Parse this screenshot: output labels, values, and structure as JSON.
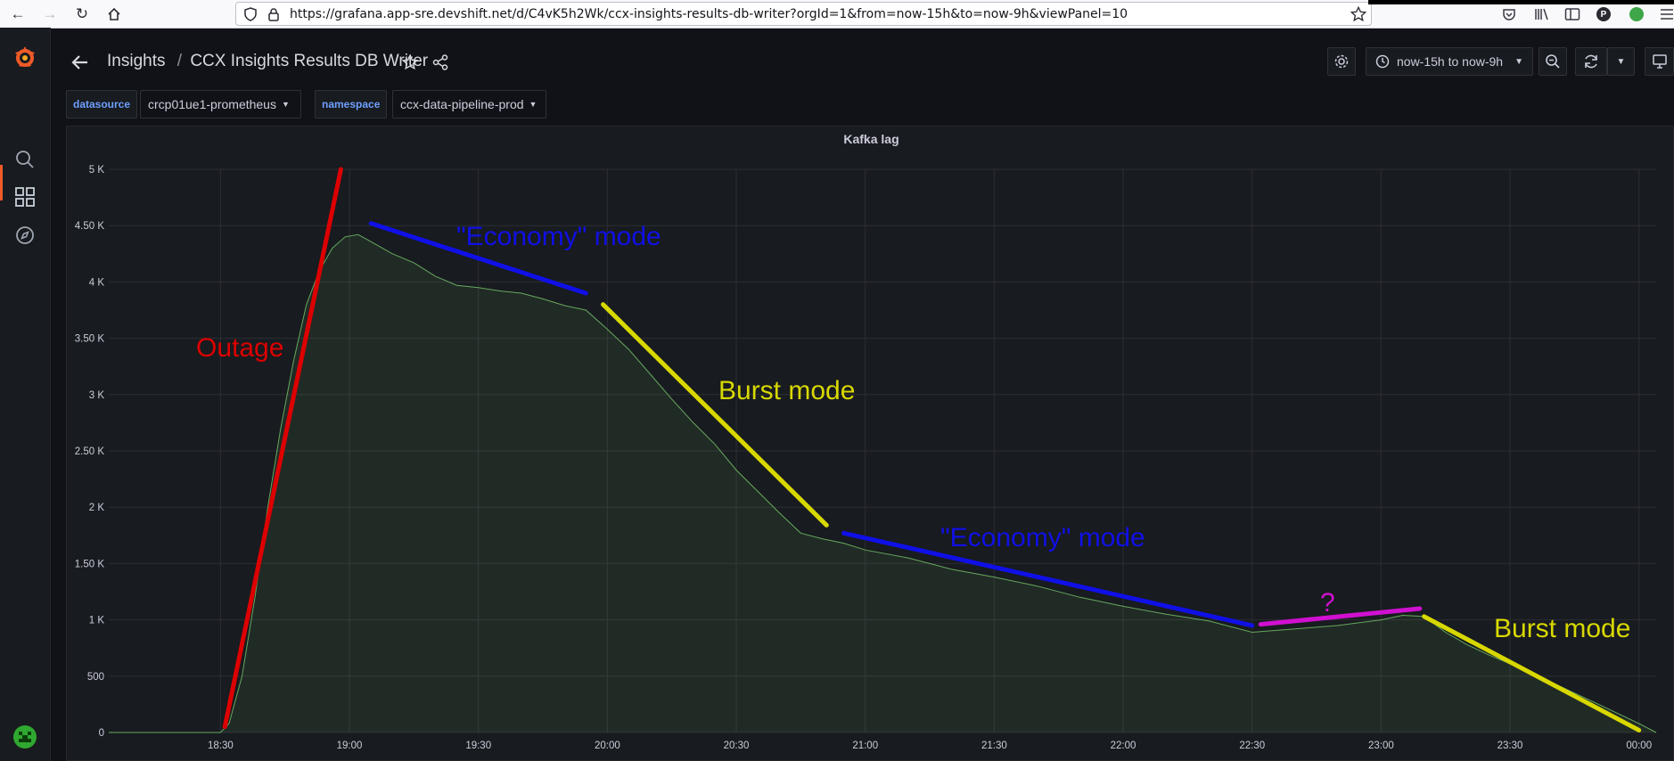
{
  "browser": {
    "url": "https://grafana.app-sre.devshift.net/d/C4vK5h2Wk/ccx-insights-results-db-writer?orgId=1&from=now-15h&to=now-9h&viewPanel=10",
    "profile_initial": "P"
  },
  "header": {
    "breadcrumb_folder": "Insights",
    "breadcrumb_sep": "/",
    "dashboard_title": "CCX Insights Results DB Writer",
    "time_range": "now-15h to now-9h"
  },
  "variables": [
    {
      "label": "datasource",
      "value": "crcp01ue1-prometheus"
    },
    {
      "label": "namespace",
      "value": "ccx-data-pipeline-prod"
    }
  ],
  "panel": {
    "title": "Kafka lag"
  },
  "chart_data": {
    "type": "area",
    "title": "Kafka lag",
    "y_ticks": [
      "0",
      "500",
      "1 K",
      "1.50 K",
      "2 K",
      "2.50 K",
      "3 K",
      "3.50 K",
      "4 K",
      "4.50 K",
      "5 K"
    ],
    "x_ticks": [
      "18:30",
      "19:00",
      "19:30",
      "20:00",
      "20:30",
      "21:00",
      "21:30",
      "22:00",
      "22:30",
      "23:00",
      "23:30",
      "00:00"
    ],
    "ylim": [
      0,
      5000
    ],
    "xlim": [
      "18:04",
      "00:04"
    ],
    "grid": true,
    "series": [
      {
        "color": "#73bf69",
        "x": [
          "18:04",
          "18:30",
          "18:32",
          "18:35",
          "18:38",
          "18:41",
          "18:44",
          "18:47",
          "18:50",
          "18:53",
          "18:56",
          "18:59",
          "19:02",
          "19:04",
          "19:10",
          "19:15",
          "19:20",
          "19:25",
          "19:30",
          "19:35",
          "19:40",
          "19:45",
          "19:50",
          "19:55",
          "20:00",
          "20:05",
          "20:10",
          "20:15",
          "20:20",
          "20:25",
          "20:30",
          "20:35",
          "20:40",
          "20:45",
          "20:50",
          "20:55",
          "21:00",
          "21:10",
          "21:20",
          "21:30",
          "21:40",
          "21:50",
          "22:00",
          "22:10",
          "22:20",
          "22:30",
          "22:40",
          "22:50",
          "23:00",
          "23:05",
          "23:10",
          "23:15",
          "23:20",
          "23:25",
          "23:30",
          "23:40",
          "23:50",
          "00:00",
          "00:04"
        ],
        "y": [
          0,
          0,
          80,
          500,
          1200,
          2000,
          2700,
          3300,
          3800,
          4100,
          4300,
          4400,
          4420,
          4380,
          4250,
          4170,
          4050,
          3970,
          3950,
          3920,
          3900,
          3850,
          3790,
          3750,
          3580,
          3400,
          3180,
          2960,
          2750,
          2560,
          2330,
          2140,
          1950,
          1770,
          1720,
          1680,
          1620,
          1550,
          1450,
          1380,
          1300,
          1200,
          1120,
          1050,
          990,
          890,
          920,
          950,
          1000,
          1040,
          1030,
          890,
          780,
          690,
          610,
          440,
          260,
          80,
          0
        ]
      }
    ],
    "annotations": [
      {
        "text": "Outage",
        "color": "#dd0000",
        "from": [
          "18:31",
          50
        ],
        "to": [
          "18:58",
          5000
        ]
      },
      {
        "text": "\"Economy\" mode",
        "color": "#1010e6",
        "from": [
          "19:05",
          4520
        ],
        "to": [
          "19:55",
          3900
        ]
      },
      {
        "text": "Burst mode",
        "color": "#d8d800",
        "from": [
          "19:59",
          3800
        ],
        "to": [
          "20:51",
          1840
        ]
      },
      {
        "text": "\"Economy\" mode",
        "color": "#1010e6",
        "from": [
          "20:55",
          1770
        ],
        "to": [
          "22:30",
          950
        ]
      },
      {
        "text": "?",
        "color": "#d010d0",
        "from": [
          "22:32",
          960
        ],
        "to": [
          "23:09",
          1100
        ]
      },
      {
        "text": "Burst mode",
        "color": "#d8d800",
        "from": [
          "23:10",
          1030
        ],
        "to": [
          "00:00",
          20
        ]
      }
    ]
  }
}
